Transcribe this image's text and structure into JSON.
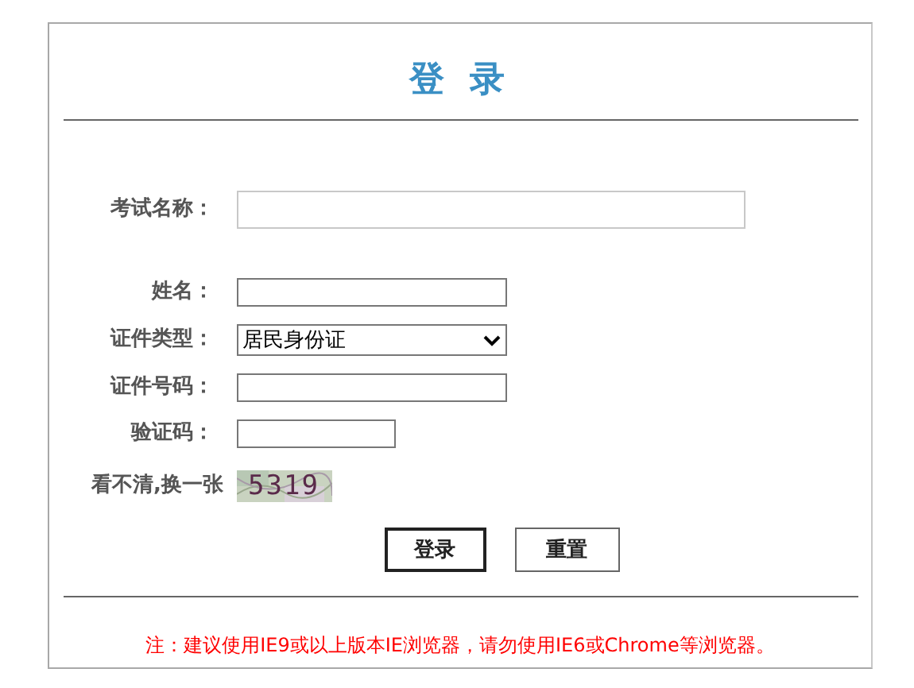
{
  "title": "登 录",
  "fields": [
    {
      "kind": "long_text",
      "label": "考试名称："
    },
    {
      "kind": "text",
      "label": "姓名："
    },
    {
      "kind": "select",
      "label": "证件类型：",
      "value": "居民身份证"
    },
    {
      "kind": "text",
      "label": "证件号码："
    },
    {
      "kind": "short_text",
      "label": "验证码："
    }
  ],
  "captcha": {
    "link": "看不清,换一张",
    "code": "5319"
  },
  "buttons": [
    {
      "label": "登录",
      "primary": true
    },
    {
      "label": "重置",
      "primary": false
    }
  ],
  "note": "注：建议使用IE9或以上版本IE浏览器，请勿使用IE6或Chrome等浏览器。"
}
